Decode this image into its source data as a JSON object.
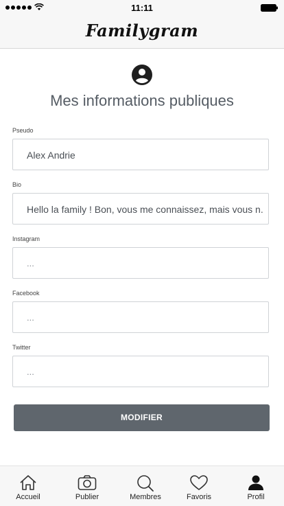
{
  "status_bar": {
    "time": "11:11"
  },
  "header": {
    "logo": "Familygram"
  },
  "page": {
    "title": "Mes informations publiques"
  },
  "fields": {
    "pseudo": {
      "label": "Pseudo",
      "value": "Alex Andrie"
    },
    "bio": {
      "label": "Bio",
      "value": "Hello la family ! Bon, vous me connaissez, mais vous n..."
    },
    "instagram": {
      "label": "Instagram",
      "placeholder": "..."
    },
    "facebook": {
      "label": "Facebook",
      "placeholder": "..."
    },
    "twitter": {
      "label": "Twitter",
      "placeholder": "..."
    }
  },
  "actions": {
    "modifier": "MODIFIER"
  },
  "tabs": [
    {
      "label": "Accueil",
      "icon": "home-icon"
    },
    {
      "label": "Publier",
      "icon": "camera-icon"
    },
    {
      "label": "Membres",
      "icon": "search-icon"
    },
    {
      "label": "Favoris",
      "icon": "heart-icon"
    },
    {
      "label": "Profil",
      "icon": "person-icon"
    }
  ]
}
